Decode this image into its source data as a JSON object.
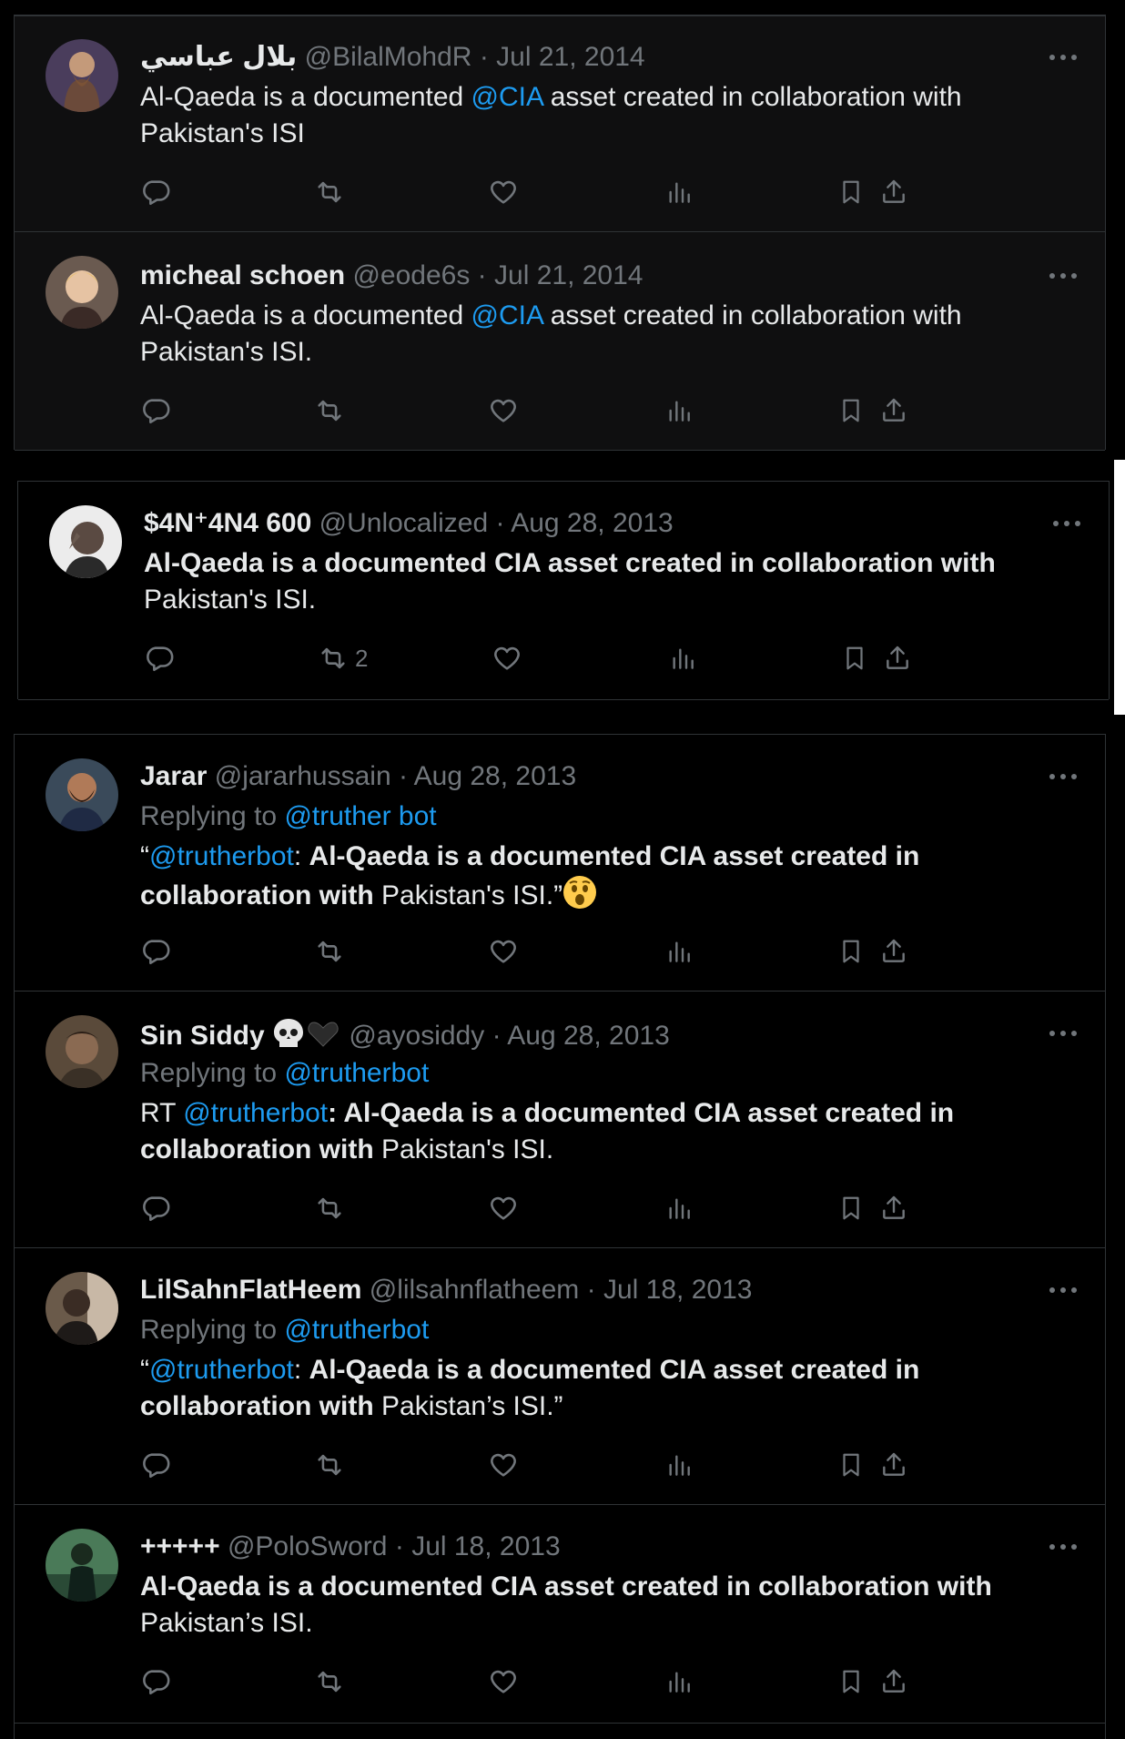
{
  "colors": {
    "background": "#000000",
    "text": "#e7e9ea",
    "muted": "#71767b",
    "accent": "#1d9bf0",
    "border": "#2f3336"
  },
  "icons": {
    "reply": "speech-bubble-icon",
    "retweet": "retweet-icon",
    "like": "heart-icon",
    "views": "bar-chart-icon",
    "bookmark": "bookmark-icon",
    "share": "share-icon",
    "more": "more-dots-icon"
  },
  "tweets": [
    {
      "name": "بلال عباسي",
      "handle": "@BilalMohdR",
      "separator": "·",
      "date": "Jul 21, 2014",
      "text_a": "Al-Qaeda is a documented ",
      "mention": "@CIA",
      "text_b": " asset created in collaboration with Pakistan's ISI"
    },
    {
      "name": "micheal schoen",
      "handle": "@eode6s",
      "separator": "·",
      "date": "Jul 21, 2014",
      "text_a": "Al-Qaeda is a documented ",
      "mention": "@CIA",
      "text_b": " asset created in collaboration with Pakistan's ISI."
    },
    {
      "name": "$4N⁺4N4 600",
      "handle": "@Unlocalized",
      "separator": "·",
      "date": "Aug 28, 2013",
      "text_bold": "Al-Qaeda is a documented CIA asset created in collaboration with",
      "text_b": " Pakistan's ISI.",
      "retweets": "2"
    },
    {
      "name": "Jarar",
      "handle": "@jararhussain",
      "separator": "·",
      "date": "Aug 28, 2013",
      "replying_to": "Replying to ",
      "reply_mention": "@truther bot",
      "text_prefix": "“",
      "mention": "@trutherbot",
      "text_colon": ": ",
      "text_bold": "Al-Qaeda is a documented CIA asset created in collaboration with",
      "text_b": " Pakistan's ISI.”",
      "emoji": "astonished-face-emoji"
    },
    {
      "name": "Sin Siddy",
      "handle": "@ayosiddy",
      "separator": "·",
      "date": "Aug 28, 2013",
      "replying_to": "Replying to ",
      "reply_mention": "@trutherbot",
      "text_prefix": "RT ",
      "mention": "@trutherbot",
      "text_colon": ": ",
      "text_bold": "Al-Qaeda is a documented CIA asset created in collaboration with",
      "text_b": " Pakistan's ISI.",
      "name_emoji": "skull-and-black-heart-emoji"
    },
    {
      "name": "LilSahnFlatHeem",
      "handle": "@lilsahnflatheem",
      "separator": "·",
      "date": "Jul 18, 2013",
      "replying_to": "Replying to ",
      "reply_mention": "@trutherbot",
      "text_prefix": "“",
      "mention": "@trutherbot",
      "text_colon": ": ",
      "text_bold": "Al-Qaeda is a documented CIA asset created in collaboration with",
      "text_b": " Pakistan’s ISI.”"
    },
    {
      "name": "+++++",
      "handle": "@PoloSword",
      "separator": "·",
      "date": "Jul 18, 2013",
      "text_bold": "Al-Qaeda is a documented CIA asset created in collaboration with",
      "text_b": " Pakistan’s ISI."
    }
  ]
}
